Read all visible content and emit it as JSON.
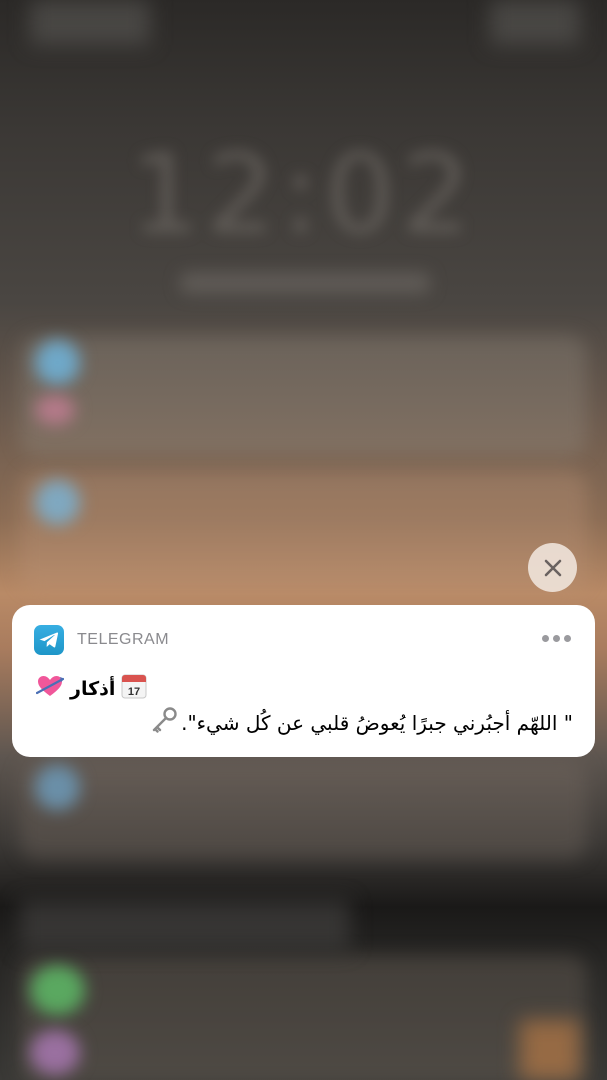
{
  "notification": {
    "app_name": "TELEGRAM",
    "title": "أذكار",
    "body": "\" اللهّم أجبُرني جبرًا يُعوضُ قلبي عن كُل شيء\".",
    "calendar_day": "17",
    "icons": {
      "app": "telegram-icon",
      "title_left": "heart-icon",
      "title_right": "calendar-icon",
      "body_trailing": "key-icon",
      "more": "more-icon",
      "close": "close-icon"
    }
  },
  "colors": {
    "card_background": "#ffffff",
    "app_name": "#8a8a8e",
    "telegram_blue": "#2aa3dd",
    "close_background": "#eee2d8"
  }
}
